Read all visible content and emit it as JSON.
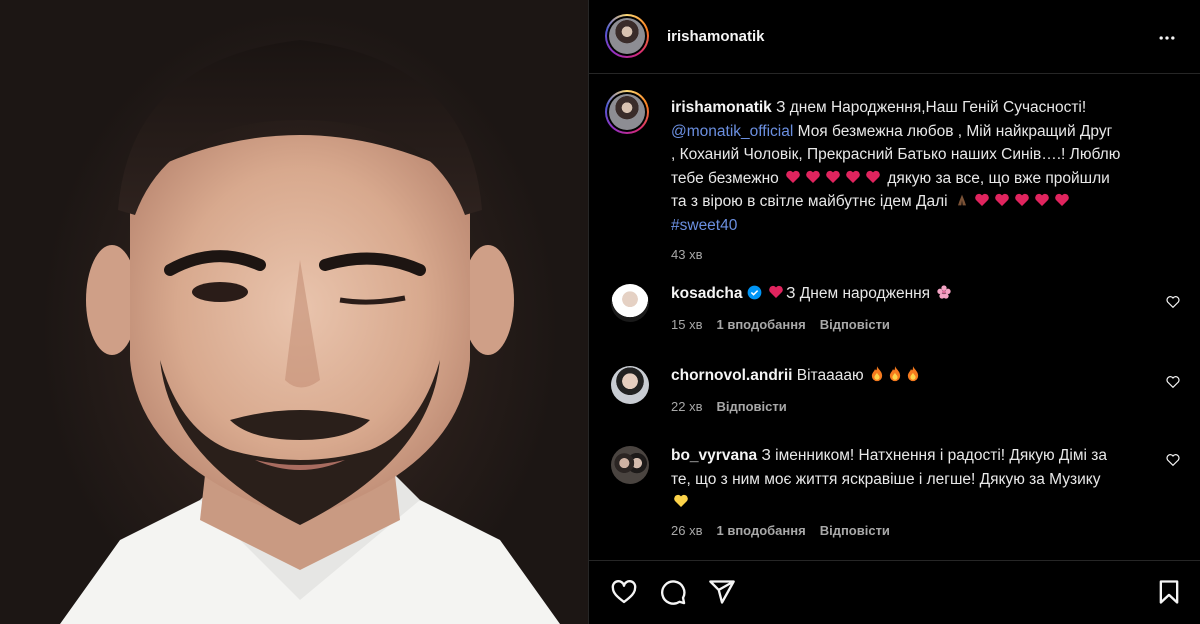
{
  "post": {
    "username": "irishamonatik",
    "caption": {
      "line1": "З днем Народження,Наш Геній Сучасності!",
      "mention": "@monatik_official",
      "line2": " Моя безмежна любов , Мій найкращий Друг",
      "line3": ", Коханий Чоловік, Прекрасний Батько наших Синів….! Люблю",
      "line4a": "тебе безмежно",
      "line4b": "дякую за все, що вже пройшли",
      "line5": "та з вірою в світле майбутнє ідем Далі",
      "hashtag": "#sweet40"
    },
    "time": "43 хв"
  },
  "comments": [
    {
      "username": "kosadcha",
      "verified": true,
      "text": "З Днем народження",
      "time": "15 хв",
      "likes": "1 вподобання",
      "reply": "Відповісти"
    },
    {
      "username": "chornovol.andrii",
      "text": "Вітааааю",
      "time": "22 хв",
      "reply": "Відповісти"
    },
    {
      "username": "bo_vyrvana",
      "text_line1": "З іменником! Натхнення і радості! Дякую Дімі за",
      "text_line2": "те, що з ним моє життя яскравіше і легше! Дякую за Музику",
      "time": "26 хв",
      "likes": "1 вподобання",
      "reply": "Відповісти"
    }
  ],
  "icons": {
    "more": "more-options-icon",
    "like": "heart-icon",
    "comment": "comment-icon",
    "share": "share-icon",
    "save": "bookmark-icon"
  },
  "colors": {
    "background": "#000000",
    "text": "#f5f5f5",
    "muted": "#a8a8a8",
    "link": "#6b8fe0",
    "heart": "#e0245e",
    "verified": "#0095f6"
  }
}
